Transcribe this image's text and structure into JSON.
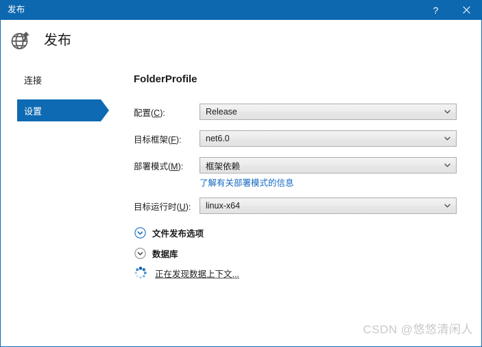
{
  "titlebar": {
    "title": "发布",
    "help_label": "?",
    "help_icon": "question-mark-icon",
    "close_icon": "close-icon"
  },
  "header": {
    "icon": "globe-publish-icon",
    "title": "发布"
  },
  "sidebar": {
    "items": [
      {
        "label": "连接",
        "selected": false,
        "name": "sidebar-item-connection"
      },
      {
        "label": "设置",
        "selected": true,
        "name": "sidebar-item-settings"
      }
    ]
  },
  "main": {
    "profile_title": "FolderProfile",
    "fields": [
      {
        "label_prefix": "配置(",
        "accel": "C",
        "label_suffix": "):",
        "value": "Release",
        "name": "configuration"
      },
      {
        "label_prefix": "目标框架(",
        "accel": "F",
        "label_suffix": "):",
        "value": "net6.0",
        "name": "target-framework"
      },
      {
        "label_prefix": "部署模式(",
        "accel": "M",
        "label_suffix": "):",
        "value": "框架依赖",
        "name": "deployment-mode"
      },
      {
        "label_prefix": "目标运行时(",
        "accel": "U",
        "label_suffix": "):",
        "value": "linux-x64",
        "name": "target-runtime"
      }
    ],
    "help_link": "了解有关部署模式的信息",
    "expanders": [
      {
        "label": "文件发布选项",
        "state": "collapsed",
        "accent": "#1268c3"
      },
      {
        "label": "数据库",
        "state": "collapsed",
        "accent": "#767676"
      }
    ],
    "status": {
      "text": "正在发现数据上下文...",
      "spinner": "loading-spinner"
    }
  },
  "watermark": "CSDN @悠悠清闲人",
  "colors": {
    "titlebar": "#0d68b0",
    "accent": "#0d6ab3",
    "link": "#1268c3",
    "text": "#1b1b1b",
    "combo_border": "#acacac",
    "watermark": "#c9c9c9"
  }
}
